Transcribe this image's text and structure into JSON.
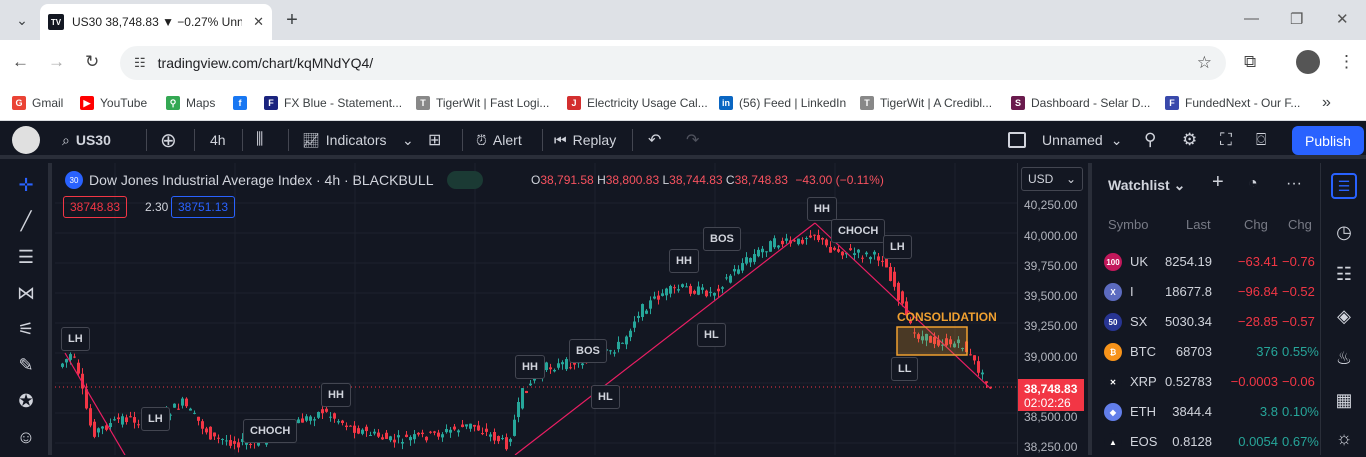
{
  "browser": {
    "tab_title": "US30 38,748.83 ▼ −0.27% Unn",
    "tab_favicon": "TV",
    "url": "tradingview.com/chart/kqMNdYQ4/",
    "bookmarks": [
      {
        "label": "Gmail",
        "icon": "gmail-icon",
        "color": "#ea4335"
      },
      {
        "label": "YouTube",
        "icon": "youtube-icon",
        "color": "#ff0000"
      },
      {
        "label": "Maps",
        "icon": "maps-icon",
        "color": "#34a853"
      },
      {
        "label": "",
        "icon": "facebook-icon",
        "color": "#1877f2"
      },
      {
        "label": "FX Blue - Statement...",
        "icon": "fxblue-icon",
        "color": "#1a237e"
      },
      {
        "label": "TigerWit | Fast Logi...",
        "icon": "tigerwit-icon",
        "color": "#888888"
      },
      {
        "label": "Electricity Usage Cal...",
        "icon": "electricity-icon",
        "color": "#d32f2f"
      },
      {
        "label": "(56) Feed | LinkedIn",
        "icon": "linkedin-icon",
        "color": "#0a66c2"
      },
      {
        "label": "TigerWit | A Credibl...",
        "icon": "tigerwit-icon",
        "color": "#888888"
      },
      {
        "label": "Dashboard - Selar D...",
        "icon": "selar-icon",
        "color": "#6a1b4d"
      },
      {
        "label": "FundedNext - Our F...",
        "icon": "fundednext-icon",
        "color": "#3949ab"
      }
    ]
  },
  "toolbar": {
    "symbol": "US30",
    "interval": "4h",
    "indicators": "Indicators",
    "alert": "Alert",
    "replay": "Replay",
    "layout_name": "Unnamed",
    "publish": "Publish"
  },
  "chart": {
    "title": "Dow Jones Industrial Average Index · 4h · BLACKBULL",
    "symbol_badge": "30",
    "ohlc": {
      "o_label": "O",
      "o": "38,791.58",
      "h_label": "H",
      "h": "38,800.83",
      "l_label": "L",
      "l": "38,744.83",
      "c_label": "C",
      "c": "38,748.83",
      "change": "−43.00 (−0.11%)"
    },
    "bid": "38748.83",
    "spread": "2.30",
    "ask": "38751.13",
    "labels": {
      "lh1": "LH",
      "lh2": "LH",
      "choch1": "CHOCH",
      "hh1": "HH",
      "hh2": "HH",
      "bos1": "BOS",
      "hl1": "HL",
      "hh3": "HH",
      "bos2": "BOS",
      "hl2": "HL",
      "hh4": "HH",
      "choch2": "CHOCH",
      "lh3": "LH",
      "ll": "LL",
      "lh4": "LH"
    },
    "consolidation": "CONSOLIDATION",
    "currency": "USD",
    "price_ticks": [
      "40,250.00",
      "40,000.00",
      "39,750.00",
      "39,500.00",
      "39,250.00",
      "39,000.00",
      "38,500.00",
      "38,250.00"
    ],
    "current_price": "38,748.83",
    "countdown": "02:02:26"
  },
  "watchlist": {
    "title": "Watchlist",
    "columns": [
      "Symbo",
      "Last",
      "Chg",
      "Chg"
    ],
    "rows": [
      {
        "badge": "100",
        "badge_color": "#c2185b",
        "symbol": "UK",
        "last": "8254.19",
        "chg": "−63.41",
        "chgp": "−0.76",
        "dir": "down"
      },
      {
        "badge": "X",
        "badge_color": "#5c6bc0",
        "symbol": "I",
        "last": "18677.8",
        "chg": "−96.84",
        "chgp": "−0.52",
        "dir": "down"
      },
      {
        "badge": "50",
        "badge_color": "#283593",
        "symbol": "SX",
        "last": "5030.34",
        "chg": "−28.85",
        "chgp": "−0.57",
        "dir": "down"
      },
      {
        "badge": "₿",
        "badge_color": "#f7931a",
        "symbol": "BTC",
        "last": "68703",
        "chg": "376",
        "chgp": "0.55%",
        "dir": "up"
      },
      {
        "badge": "✕",
        "badge_color": "#131722",
        "symbol": "XRP",
        "last": "0.52783",
        "chg": "−0.0003",
        "chgp": "−0.06",
        "dir": "down"
      },
      {
        "badge": "◆",
        "badge_color": "#627eea",
        "symbol": "ETH",
        "last": "3844.4",
        "chg": "3.8",
        "chgp": "0.10%",
        "dir": "up"
      },
      {
        "badge": "▲",
        "badge_color": "#131722",
        "symbol": "EOS",
        "last": "0.8128",
        "chg": "0.0054",
        "chgp": "0.67%",
        "dir": "up"
      }
    ]
  },
  "colors": {
    "up": "#26a69a",
    "down": "#f23645",
    "accent": "#2962ff",
    "trend": "#e91e63"
  }
}
